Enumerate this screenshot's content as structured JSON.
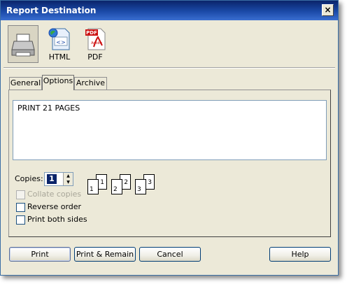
{
  "window": {
    "title": "Report Destination",
    "close_label": "×"
  },
  "destinations": [
    {
      "name": "printer",
      "label": ""
    },
    {
      "name": "html",
      "label": "HTML"
    },
    {
      "name": "pdf",
      "label": "PDF"
    }
  ],
  "tabs": [
    {
      "label": "General"
    },
    {
      "label": "Options"
    },
    {
      "label": "Archive"
    }
  ],
  "options": {
    "notes_text": "PRINT 21 PAGES",
    "copies_label": "Copies:",
    "copies_value": "1",
    "page_icons": [
      "1",
      "1",
      "2",
      "2",
      "3",
      "3"
    ],
    "collate_label": "Collate copies",
    "reverse_label": "Reverse order",
    "both_sides_label": "Print both sides"
  },
  "buttons": {
    "print": "Print",
    "print_remain": "Print & Remain",
    "cancel": "Cancel",
    "help": "Help"
  },
  "colors": {
    "titlebar": "#0a246a",
    "dialog_bg": "#ece9d8",
    "selection": "#0a246a"
  }
}
